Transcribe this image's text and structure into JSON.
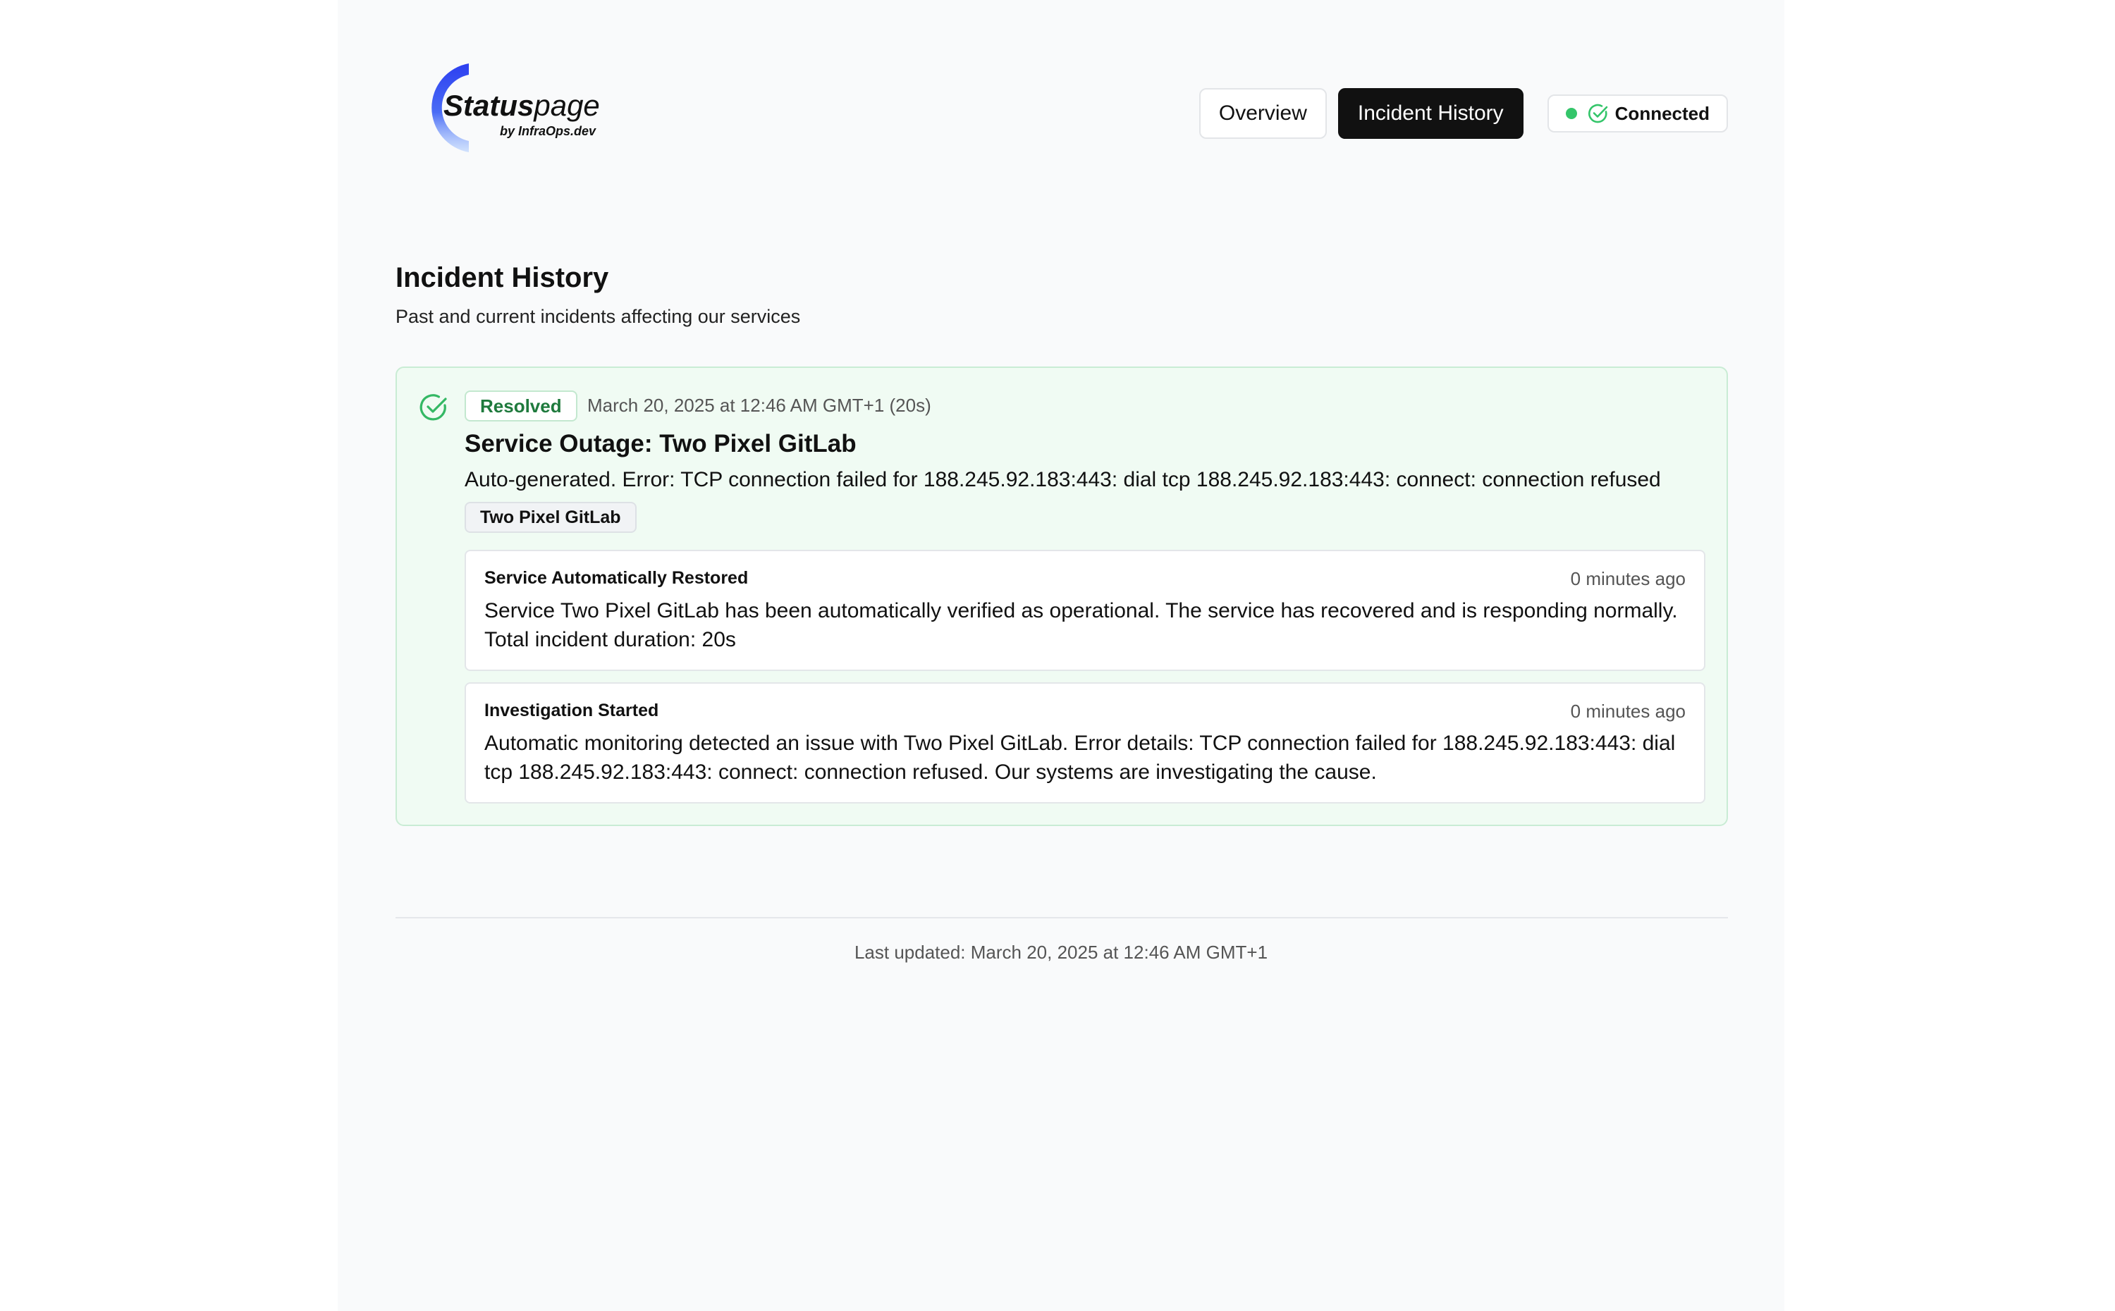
{
  "brand": {
    "name_strong": "Status",
    "name_light": "page",
    "byline": "by InfraOps.dev"
  },
  "nav": {
    "overview": "Overview",
    "incident_history": "Incident History",
    "active": "Incident History"
  },
  "connection": {
    "label": "Connected",
    "status_color": "#34c56a"
  },
  "main": {
    "title": "Incident History",
    "subtitle": "Past and current incidents affecting our services"
  },
  "incidents": [
    {
      "status": "Resolved",
      "status_color": "#1f7a3d",
      "date": "March 20, 2025 at 12:46 AM GMT+1 (20s)",
      "title": "Service Outage: Two Pixel GitLab",
      "description": "Auto-generated. Error: TCP connection failed for 188.245.92.183:443: dial tcp 188.245.92.183:443: connect: connection refused",
      "service_tag": "Two Pixel GitLab",
      "updates": [
        {
          "title": "Service Automatically Restored",
          "time": "0 minutes ago",
          "body": "Service Two Pixel GitLab has been automatically verified as operational. The service has recovered and is responding normally. Total incident duration: 20s"
        },
        {
          "title": "Investigation Started",
          "time": "0 minutes ago",
          "body": "Automatic monitoring detected an issue with Two Pixel GitLab. Error details: TCP connection failed for 188.245.92.183:443: dial tcp 188.245.92.183:443: connect: connection refused. Our systems are investigating the cause."
        }
      ]
    }
  ],
  "footer": {
    "last_updated": "Last updated: March 20, 2025 at 12:46 AM GMT+1"
  },
  "icons": {
    "logo": "statuspage-logo-arc",
    "connection": "check-circle-icon",
    "incident": "check-circle-icon"
  }
}
